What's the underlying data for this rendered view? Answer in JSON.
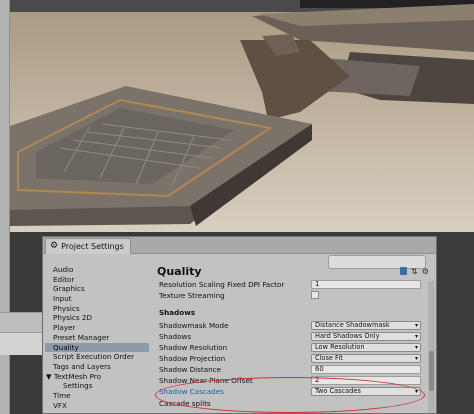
{
  "window": {
    "title": "Project Settings",
    "icon": "gear-icon"
  },
  "sidebar": {
    "items": [
      {
        "label": "Audio"
      },
      {
        "label": "Editor"
      },
      {
        "label": "Graphics"
      },
      {
        "label": "Input"
      },
      {
        "label": "Physics"
      },
      {
        "label": "Physics 2D"
      },
      {
        "label": "Player"
      },
      {
        "label": "Preset Manager"
      },
      {
        "label": "Quality",
        "selected": true
      },
      {
        "label": "Script Execution Order"
      },
      {
        "label": "Tags and Layers"
      },
      {
        "label": "TextMesh Pro",
        "expanded": true
      },
      {
        "label": "Settings",
        "indent": true
      },
      {
        "label": "Time"
      },
      {
        "label": "VFX"
      }
    ]
  },
  "content": {
    "heading": "Quality",
    "rows": {
      "resolution_scaling": {
        "label": "Resolution Scaling Fixed DPI Factor",
        "value": "1"
      },
      "texture_streaming": {
        "label": "Texture Streaming"
      },
      "shadows_section": {
        "label": "Shadows"
      },
      "shadowmask_mode": {
        "label": "Shadowmask Mode",
        "value": "Distance Shadowmask"
      },
      "shadows": {
        "label": "Shadows",
        "value": "Hard Shadows Only"
      },
      "shadow_resolution": {
        "label": "Shadow Resolution",
        "value": "Low Resolution"
      },
      "shadow_projection": {
        "label": "Shadow Projection",
        "value": "Close Fit"
      },
      "shadow_distance": {
        "label": "Shadow Distance",
        "value": "60"
      },
      "shadow_near_plane": {
        "label": "Shadow Near Plane Offset",
        "value": "2"
      },
      "shadow_cascades": {
        "label": "Shadow Cascades",
        "value": "Two Cascades"
      },
      "cascade_splits": {
        "label": "Cascade splits"
      }
    }
  },
  "colors": {
    "selection": "#8e9aab",
    "highlight_label": "#1a5fb4",
    "annotation_ellipse": "#d23030"
  }
}
